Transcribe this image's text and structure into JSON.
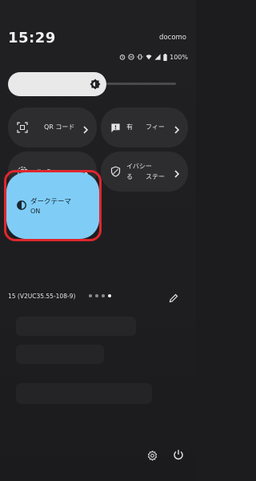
{
  "status": {
    "time": "15:29",
    "carrier": "docomo",
    "battery": "100%",
    "icons": [
      "alarm-icon",
      "dnd-icon",
      "vibrate-icon",
      "wifi-icon",
      "signal-icon",
      "battery-icon"
    ]
  },
  "brightness": {
    "level": 0.5,
    "icon": "brightness-icon"
  },
  "tiles": [
    {
      "label": "QR コード",
      "icon": "qr-scanner-icon"
    },
    {
      "label": "有　　フィー",
      "icon": "feedback-icon"
    },
    {
      "label": "Family Space",
      "icon": "family-space-icon"
    },
    {
      "label_line1": "イバシー",
      "label_line2": "る　　ステー",
      "icon": "privacy-shield-icon"
    }
  ],
  "dark_mode": {
    "title": "ダークテーマ",
    "state": "ON",
    "icon": "dark-theme-icon",
    "color": "#7fcdf7"
  },
  "footer": {
    "build": "15 (V2UC35.55-108-9)",
    "page_count": 4,
    "active_page": 4
  },
  "colors": {
    "highlight": "#e0262e",
    "tile_bg": "#2d2d2f",
    "background": "#1c1c1e"
  }
}
